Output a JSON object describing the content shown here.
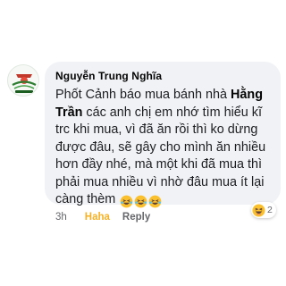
{
  "comment": {
    "author": "Nguyễn Trung Nghĩa",
    "text_start": "Phốt  Cảnh báo mua bánh nhà ",
    "tagged_name": "Hằng Trần",
    "text_end": " các anh chị em nhớ tìm hiểu kĩ trc khi mua, vì đã ăn rồi thì ko dừng được đâu, sẽ gây cho mình ăn nhiều hơn đầy nhé, mà một khi đã mua thì phải mua nhiều vì nhờ đâu mua ít lại càng thèm ",
    "emojis": [
      "rofl-emoji",
      "rofl-emoji",
      "rofl-emoji"
    ]
  },
  "actions": {
    "time": "3h",
    "reaction_label": "Haha",
    "reply_label": "Reply"
  },
  "reaction_badge": {
    "icon": "haha-emoji",
    "count": "2"
  },
  "colors": {
    "bubble": "#f0f2f5",
    "haha_accent": "#f7b125",
    "secondary_text": "#65676b"
  }
}
